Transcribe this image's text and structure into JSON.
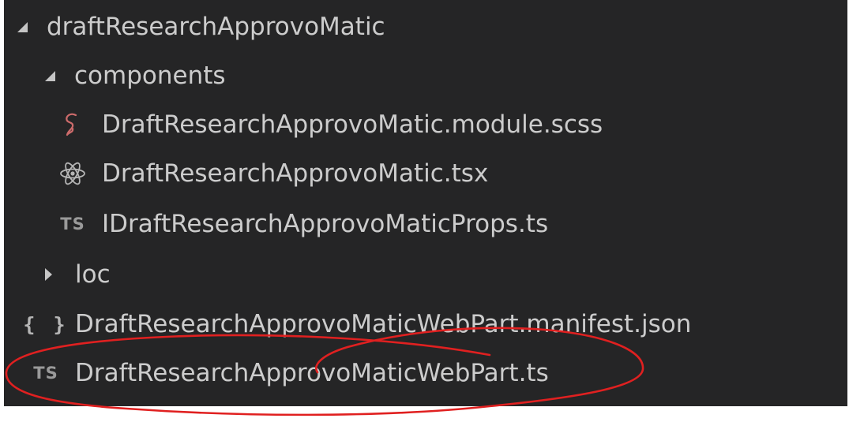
{
  "explorer": {
    "root": {
      "label": "draftResearchApprovoMatic",
      "expanded": true
    },
    "components": {
      "label": "components",
      "expanded": true
    },
    "files": {
      "scss": {
        "label": "DraftResearchApprovoMatic.module.scss",
        "icon": "sass-icon"
      },
      "tsx": {
        "label": "DraftResearchApprovoMatic.tsx",
        "icon": "react-icon"
      },
      "props": {
        "label": "IDraftResearchApprovoMaticProps.ts",
        "icon": "typescript-icon",
        "badge": "TS"
      }
    },
    "loc": {
      "label": "loc",
      "expanded": false
    },
    "manifest": {
      "label": "DraftResearchApprovoMaticWebPart.manifest.json",
      "icon": "json-icon",
      "badge": "{ }"
    },
    "webpart": {
      "label": "DraftResearchApprovoMaticWebPart.ts",
      "icon": "typescript-icon",
      "badge": "TS",
      "highlighted": true
    }
  },
  "colors": {
    "background": "#252526",
    "text": "#cccccc",
    "annotation": "#e02020",
    "sass": "#cd6b6b"
  }
}
